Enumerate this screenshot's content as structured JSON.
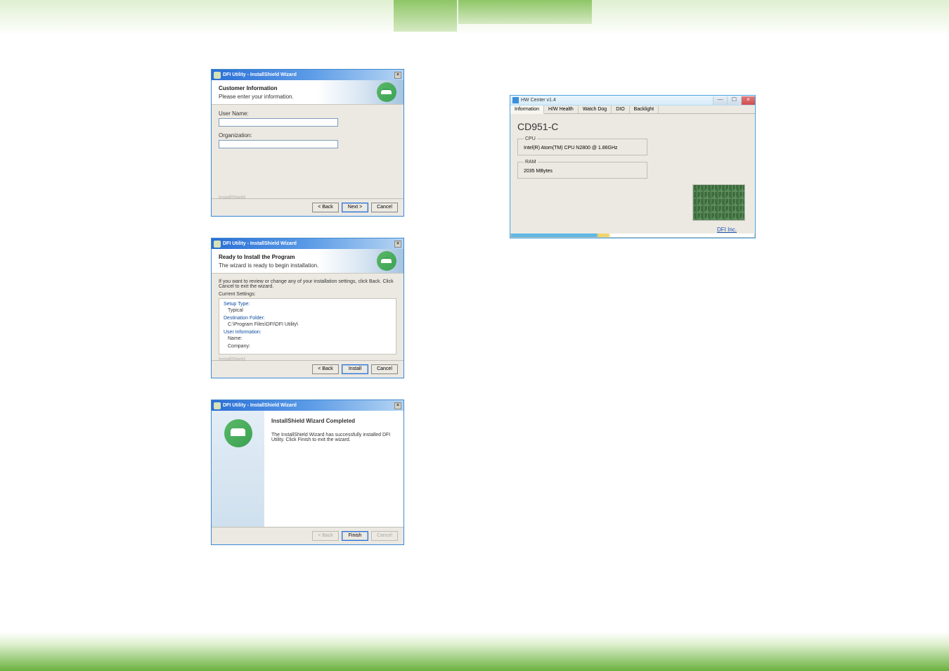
{
  "wizard1": {
    "window_title": "DFI Utility - InstallShield Wizard",
    "header_title": "Customer Information",
    "header_sub": "Please enter your information.",
    "user_name_label": "User Name:",
    "organization_label": "Organization:",
    "brand": "InstallShield",
    "btn_back": "< Back",
    "btn_next": "Next >",
    "btn_cancel": "Cancel",
    "close_x": "×"
  },
  "wizard2": {
    "window_title": "DFI Utility - InstallShield Wizard",
    "header_title": "Ready to Install the Program",
    "header_sub": "The wizard is ready to begin installation.",
    "intro": "If you want to review or change any of your installation settings, click Back. Click Cancel to exit the wizard.",
    "cur_settings": "Current Settings:",
    "setup_type_label": "Setup Type:",
    "setup_type_value": "Typical",
    "dest_folder_label": "Destination Folder:",
    "dest_folder_value": "C:\\Program Files\\DFI\\DFI Utility\\",
    "user_info_label": "User Information:",
    "user_name_label": "Name:",
    "user_company_label": "Company:",
    "brand": "InstallShield",
    "btn_back": "< Back",
    "btn_install": "Install",
    "btn_cancel": "Cancel",
    "close_x": "×"
  },
  "wizard3": {
    "window_title": "DFI Utility - InstallShield Wizard",
    "heading": "InstallShield Wizard Completed",
    "body_text": "The InstallShield Wizard has successfully installed DFI Utility. Click Finish to exit the wizard.",
    "btn_back": "< Back",
    "btn_finish": "Finish",
    "btn_cancel": "Cancel",
    "close_x": "×"
  },
  "hwcenter": {
    "window_title": "HW Center v1.4",
    "tabs": {
      "info": "Information",
      "hw": "H/W Health",
      "wd": "Watch Dog",
      "dio": "DIO",
      "bl": "Backlight"
    },
    "board_name": "CD951-C",
    "cpu_legend": "CPU",
    "cpu_value": "Intel(R) Atom(TM) CPU N2800   @ 1.86GHz",
    "ram_legend": "RAM",
    "ram_value": "2035 MBytes",
    "dfi_link": "DFI Inc.",
    "minimize": "—",
    "maximize": "☐",
    "close": "×"
  }
}
